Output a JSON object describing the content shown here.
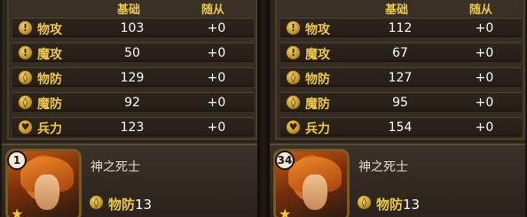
{
  "headers": {
    "base": "基础",
    "follow": "随从"
  },
  "panels": [
    {
      "stats": [
        {
          "icon": "sword-icon",
          "name": "物攻",
          "base": "103",
          "follow": "+0"
        },
        {
          "icon": "magic-icon",
          "name": "魔攻",
          "base": "50",
          "follow": "+0"
        },
        {
          "icon": "shield-icon",
          "name": "物防",
          "base": "129",
          "follow": "+0"
        },
        {
          "icon": "magic-shield-icon",
          "name": "魔防",
          "base": "92",
          "follow": "+0"
        },
        {
          "icon": "heart-icon",
          "name": "兵力",
          "base": "123",
          "follow": "+0"
        }
      ],
      "hero": {
        "level": "1",
        "name": "神之死士",
        "stat_name": "物防",
        "stat_value": "13"
      }
    },
    {
      "stats": [
        {
          "icon": "sword-icon",
          "name": "物攻",
          "base": "112",
          "follow": "+0"
        },
        {
          "icon": "magic-icon",
          "name": "魔攻",
          "base": "67",
          "follow": "+0"
        },
        {
          "icon": "shield-icon",
          "name": "物防",
          "base": "127",
          "follow": "+0"
        },
        {
          "icon": "magic-shield-icon",
          "name": "魔防",
          "base": "95",
          "follow": "+0"
        },
        {
          "icon": "heart-icon",
          "name": "兵力",
          "base": "154",
          "follow": "+0"
        }
      ],
      "hero": {
        "level": "34",
        "name": "神之死士",
        "stat_name": "物防",
        "stat_value": "13"
      }
    }
  ],
  "colors": {
    "accent": "#f0c94a",
    "value": "#ffffff",
    "panel": "#332a20"
  }
}
